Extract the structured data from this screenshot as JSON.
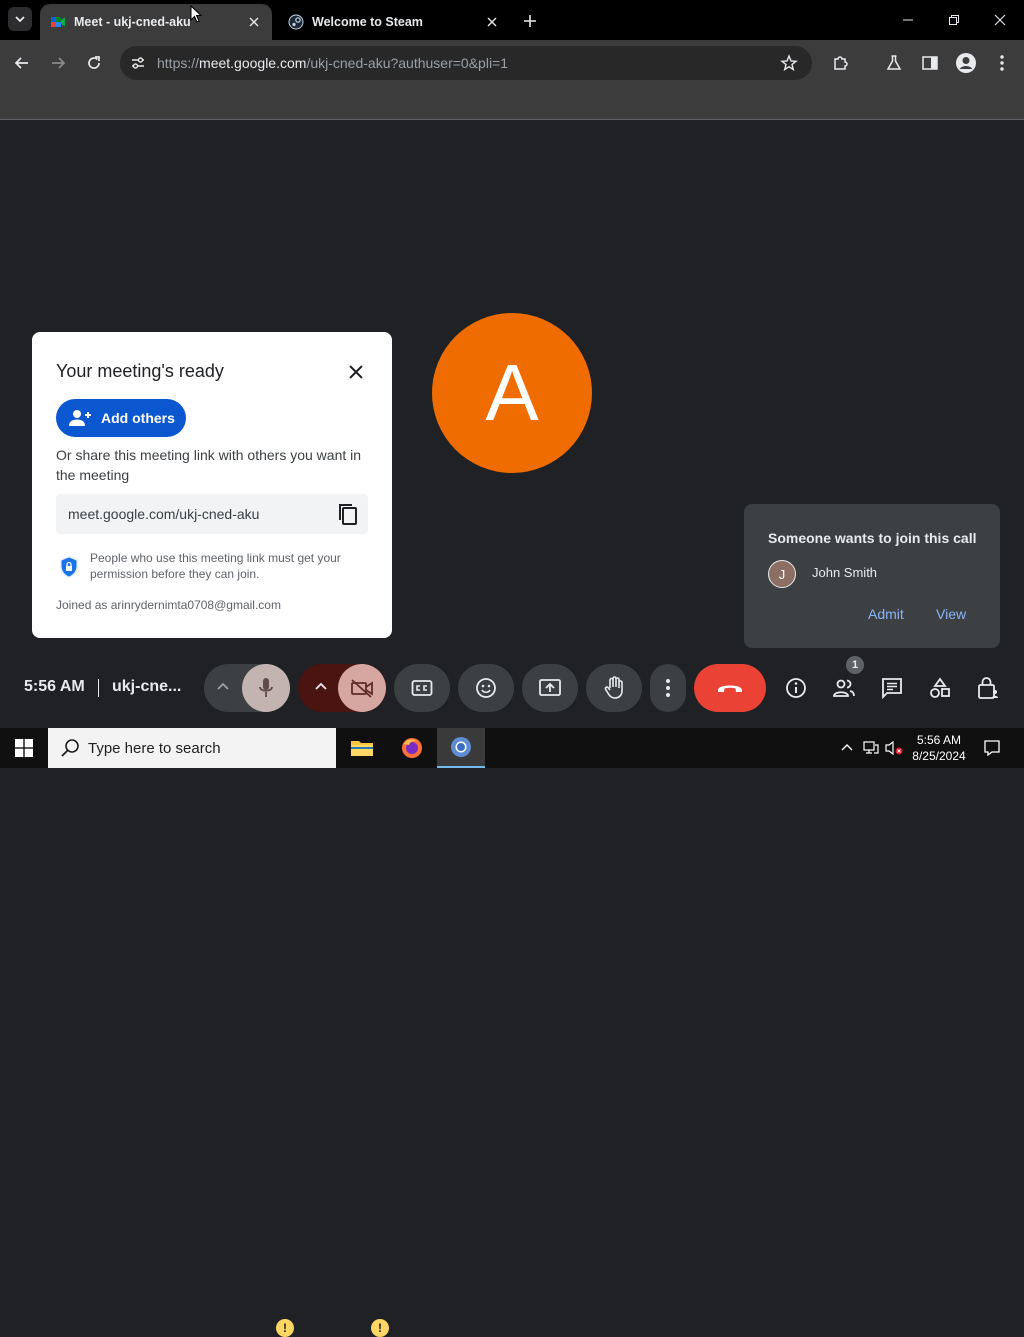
{
  "browser": {
    "tabs": [
      {
        "title": "Meet - ukj-cned-aku",
        "active": true
      },
      {
        "title": "Welcome to Steam",
        "active": false
      }
    ],
    "url_prefix": "https://",
    "url_host": "meet.google.com",
    "url_path": "/ukj-cned-aku?authuser=0&pli=1"
  },
  "meeting": {
    "avatar_letter": "A",
    "avatar_color": "#ef6c00"
  },
  "ready_card": {
    "title": "Your meeting's ready",
    "add_others_label": "Add others",
    "share_text": "Or share this meeting link with others you want in the meeting",
    "link": "meet.google.com/ukj-cned-aku",
    "permission_text": "People who use this meeting link must get your permission before they can join.",
    "joined_as": "Joined as arinrydernimta0708@gmail.com"
  },
  "join_request": {
    "title": "Someone wants to join this call",
    "avatar_letter": "J",
    "name": "John Smith",
    "admit_label": "Admit",
    "view_label": "View"
  },
  "controls": {
    "time": "5:56 AM",
    "meeting_code": "ukj-cne...",
    "mic_warning": "!",
    "cam_warning": "!",
    "people_count": "1"
  },
  "taskbar": {
    "search_placeholder": "Type here to search",
    "clock_time": "5:56 AM",
    "clock_date": "8/25/2024"
  },
  "colors": {
    "end_call": "#ea4335",
    "add_others_bg": "#0b57d0",
    "link_accent": "#8ab4f8",
    "warning": "#fdd663"
  }
}
